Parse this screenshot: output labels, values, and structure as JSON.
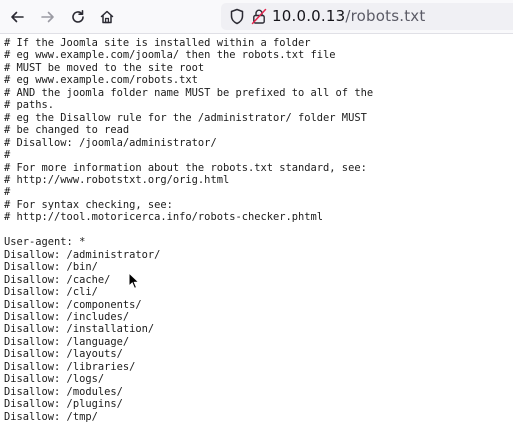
{
  "browser": {
    "url_host": "10.0.0.13",
    "url_path": "/robots.txt",
    "icons": [
      "back-arrow-icon",
      "forward-arrow-icon",
      "reload-icon",
      "home-icon",
      "shield-icon",
      "insecure-lock-icon"
    ]
  },
  "document": {
    "lines": [
      "# If the Joomla site is installed within a folder",
      "# eg www.example.com/joomla/ then the robots.txt file",
      "# MUST be moved to the site root",
      "# eg www.example.com/robots.txt",
      "# AND the joomla folder name MUST be prefixed to all of the",
      "# paths.",
      "# eg the Disallow rule for the /administrator/ folder MUST",
      "# be changed to read",
      "# Disallow: /joomla/administrator/",
      "#",
      "# For more information about the robots.txt standard, see:",
      "# http://www.robotstxt.org/orig.html",
      "#",
      "# For syntax checking, see:",
      "# http://tool.motoricerca.info/robots-checker.phtml",
      "",
      "User-agent: *",
      "Disallow: /administrator/",
      "Disallow: /bin/",
      "Disallow: /cache/",
      "Disallow: /cli/",
      "Disallow: /components/",
      "Disallow: /includes/",
      "Disallow: /installation/",
      "Disallow: /language/",
      "Disallow: /layouts/",
      "Disallow: /libraries/",
      "Disallow: /logs/",
      "Disallow: /modules/",
      "Disallow: /plugins/",
      "Disallow: /tmp/"
    ]
  }
}
